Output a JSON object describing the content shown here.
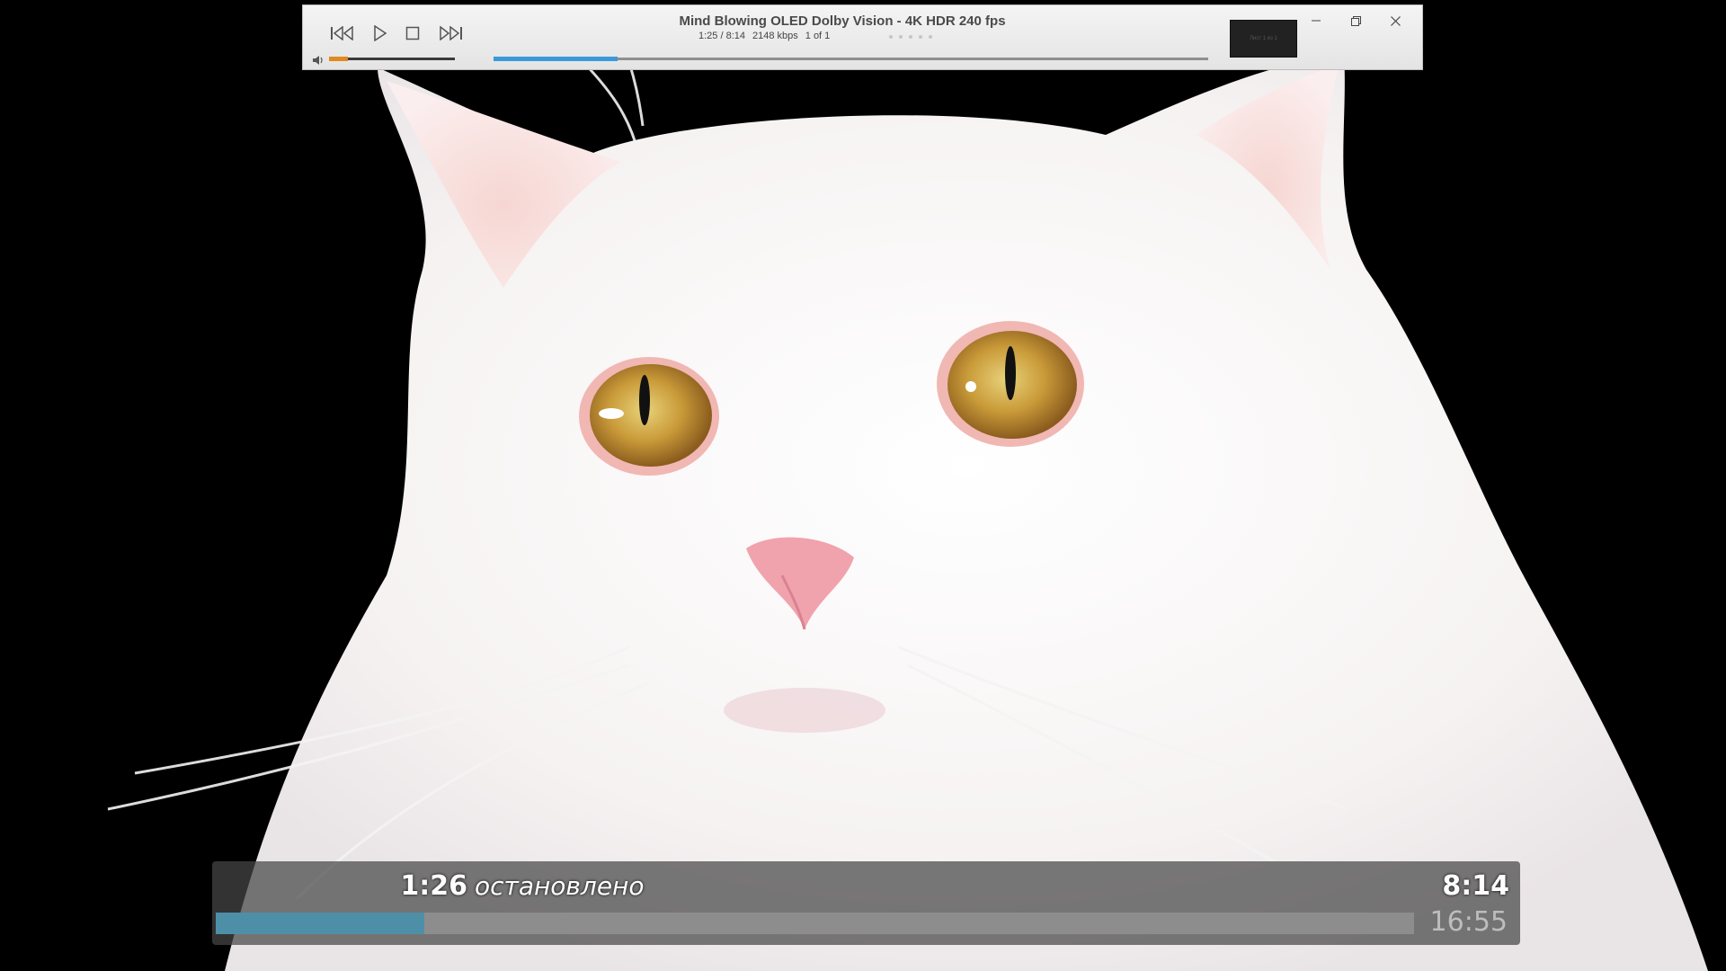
{
  "miniplayer": {
    "title": "Mind Blowing OLED Dolby Vision - 4K HDR 240 fps",
    "position": "1:25 / 8:14",
    "bitrate": "2148 kbps",
    "playlist_index": "1 of 1",
    "volume_level": 0.15,
    "seek_progress": 0.174,
    "thumb_caption": "Лист 1 из 1",
    "controls": [
      "previous-icon",
      "play-icon",
      "stop-icon",
      "next-icon"
    ],
    "window_controls": [
      "minimize-icon",
      "restore-icon",
      "close-icon"
    ],
    "colors": {
      "volume": "#e08a1c",
      "seek": "#3a9ad9"
    }
  },
  "osd": {
    "current_time": "1:26",
    "status": "остановлено",
    "total_time": "8:14",
    "clock": "16:55",
    "progress": 0.174,
    "colors": {
      "progress": "#4e8fa8"
    }
  }
}
